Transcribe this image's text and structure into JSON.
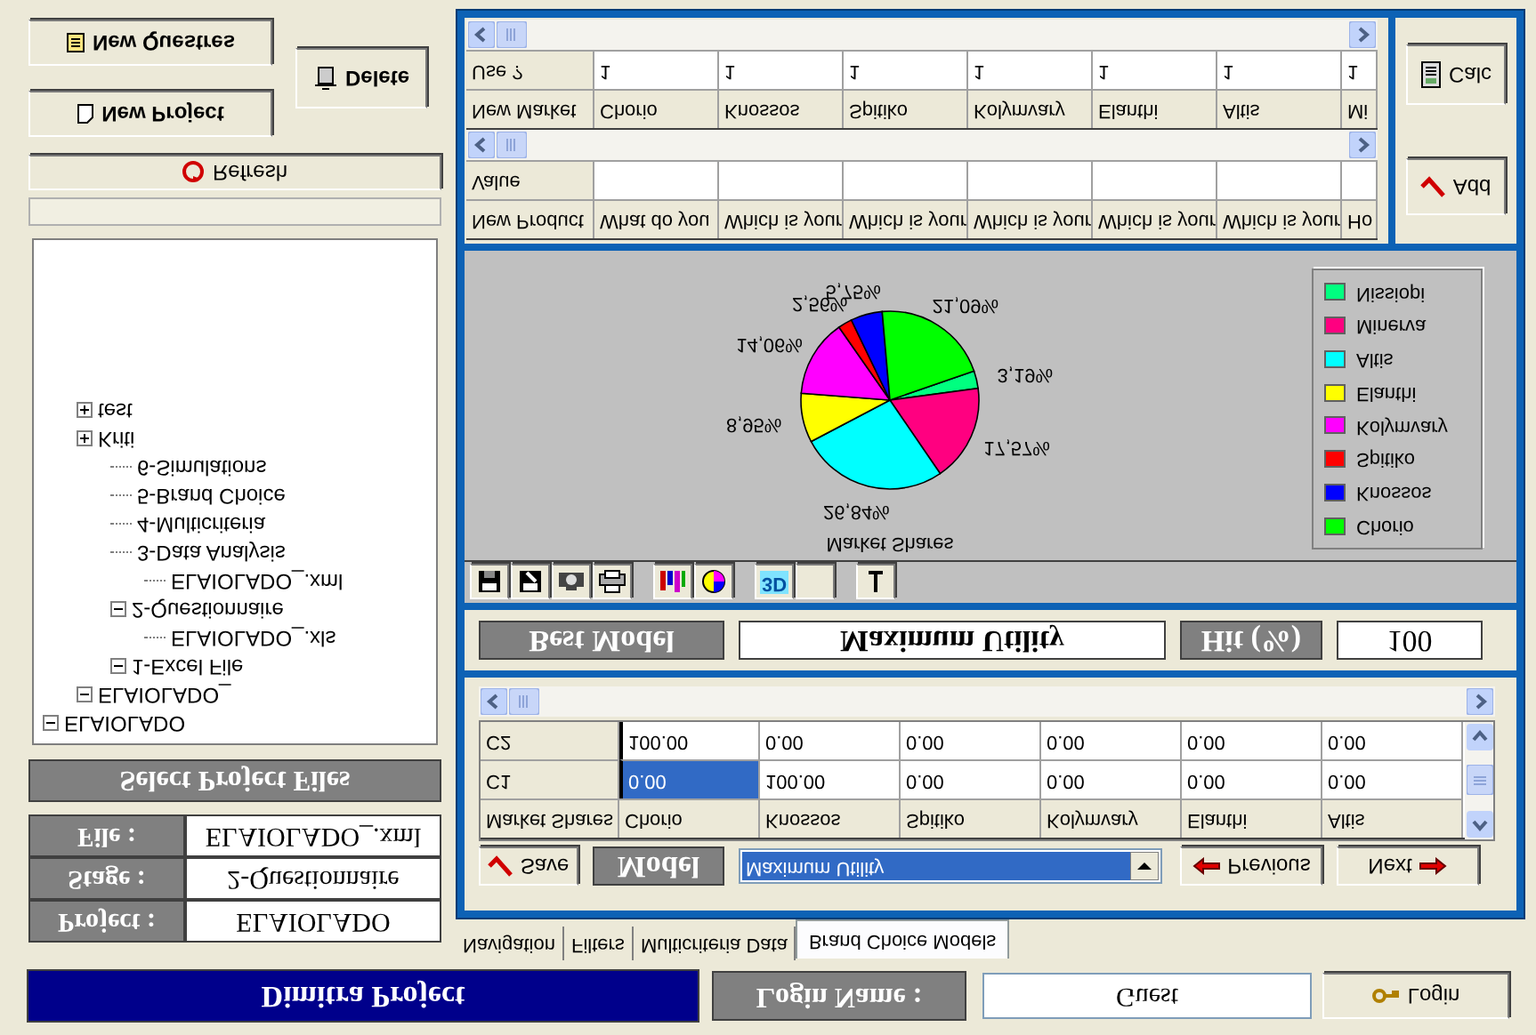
{
  "buttons": {
    "new_questionnaire": "New Questres",
    "new_project": "New Project",
    "delete": "Delete"
  },
  "refresh_button": "Refresh",
  "tree": [
    {
      "label": "ELAIOLADO",
      "expanded": true,
      "children": [
        {
          "label": "test",
          "expanded": false
        },
        {
          "label": "Kriti",
          "expanded": false
        },
        {
          "label": "ELAIOLADO_",
          "expanded": true,
          "children": [
            {
              "label": "6-Simulations"
            },
            {
              "label": "5-Brand Choice"
            },
            {
              "label": "4-Multicriteria"
            },
            {
              "label": "3-Data Analysis"
            },
            {
              "label": "2-Questionnaire",
              "expanded": true,
              "children": [
                {
                  "label": "ELAIOLADO_.xml"
                }
              ]
            },
            {
              "label": "1-Excel File",
              "expanded": true,
              "children": [
                {
                  "label": "ELAIOLADO_.xls"
                }
              ]
            }
          ]
        }
      ]
    }
  ],
  "select_button": "Select Project Files",
  "project_info": [
    {
      "label": "File :",
      "value": "ELAIOLADO_.xml"
    },
    {
      "label": "Stage :",
      "value": "2-Questionnaire"
    },
    {
      "label": "Project :",
      "value": "ELAIOLADO"
    }
  ],
  "new_market_table": {
    "rows": [
      {
        "kind": "data",
        "label": "Use ?",
        "cells": [
          "1",
          "1",
          "1",
          "1",
          "1",
          "1",
          "1"
        ]
      },
      {
        "kind": "header",
        "label": "New Market",
        "cells": [
          "Chorio",
          "Knossos",
          "Spitiko",
          "Kolymvary",
          "Elanthi",
          "Altis",
          "Mi"
        ]
      }
    ]
  },
  "calc_button": "Calc",
  "product_table": {
    "rows": [
      {
        "kind": "data",
        "label": "Value"
      },
      {
        "kind": "header",
        "label": "New Product",
        "cells": [
          "What do you",
          "Which is your",
          "Which is your",
          "Which is your",
          "Which is your",
          "Which is your",
          "Ho"
        ]
      }
    ]
  },
  "add_button": "Add",
  "chart": {
    "chart_data": {
      "type": "pie",
      "title": "Market Shares",
      "categories": [
        "Nissiopi",
        "Minerva",
        "Altis",
        "Elanthi",
        "Kolymvary",
        "Spitiko",
        "Knossos",
        "Chorio"
      ],
      "series": [
        {
          "values": [
            3.19,
            17.57,
            26.84,
            8.95,
            14.06,
            2.56,
            5.75,
            21.09
          ]
        }
      ],
      "value_labels": [
        "3,19%",
        "17,57%",
        "26,84%",
        "8,95%",
        "14,06%",
        "2,56%",
        "5,75%",
        "21,09%"
      ]
    },
    "legend": [
      {
        "color": "#00ff80"
      },
      {
        "color": "#ff0080"
      },
      {
        "color": "#00ffff"
      },
      {
        "color": "#ffff00"
      },
      {
        "color": "#ff00ff"
      },
      {
        "color": "#ff0000"
      },
      {
        "color": "#0000ff"
      },
      {
        "color": "#00ff00"
      }
    ]
  },
  "chart_toolbar": [
    {
      "kind": "save"
    },
    {
      "kind": "export"
    },
    {
      "kind": "camera"
    },
    {
      "kind": "print"
    },
    {
      "kind": "bars"
    },
    {
      "kind": "pie"
    },
    {
      "kind": "text",
      "label": "3D"
    },
    {
      "kind": "blank"
    },
    {
      "kind": "tool"
    }
  ],
  "best_model": {
    "label": "Best Model",
    "value": "Maximum Utility",
    "hit_label": "Hit (%)",
    "hit_value": "100"
  },
  "market_table": {
    "rows": [
      {
        "kind": "data",
        "label": "C2",
        "cells": [
          {
            "text": "100.00",
            "selected": false
          },
          {
            "text": "0.00",
            "selected": false
          },
          {
            "text": "0.00",
            "selected": false
          },
          {
            "text": "0.00",
            "selected": false
          },
          {
            "text": "0.00",
            "selected": false
          },
          {
            "text": "0.00",
            "selected": false
          }
        ]
      },
      {
        "kind": "data",
        "label": "C1",
        "cells": [
          {
            "text": "0.00",
            "selected": true
          },
          {
            "text": "100.00",
            "selected": false
          },
          {
            "text": "0.00",
            "selected": false
          },
          {
            "text": "0.00",
            "selected": false
          },
          {
            "text": "0.00",
            "selected": false
          },
          {
            "text": "0.00",
            "selected": false
          }
        ]
      },
      {
        "kind": "header",
        "label": "Market Shares",
        "cells": [
          {
            "text": "Chorio"
          },
          {
            "text": "Knossos"
          },
          {
            "text": "Spitiko"
          },
          {
            "text": "Kolymvary"
          },
          {
            "text": "Elanthi"
          },
          {
            "text": "Altis"
          }
        ]
      }
    ]
  },
  "model_bar": {
    "save": "Save",
    "model_label": "Model",
    "model_value": "Maximum Utility",
    "previous": "Previous",
    "next": "Next"
  },
  "tabs": [
    {
      "label": "Navigation",
      "selected": false
    },
    {
      "label": "Filters",
      "selected": false
    },
    {
      "label": "Multicriteria Data",
      "selected": false
    },
    {
      "label": "Brand Choice Models",
      "selected": true
    }
  ],
  "header": {
    "title": "Dimitra Project",
    "login_label": "Login Name :",
    "login_name": "Guest",
    "login_button": "Login"
  }
}
